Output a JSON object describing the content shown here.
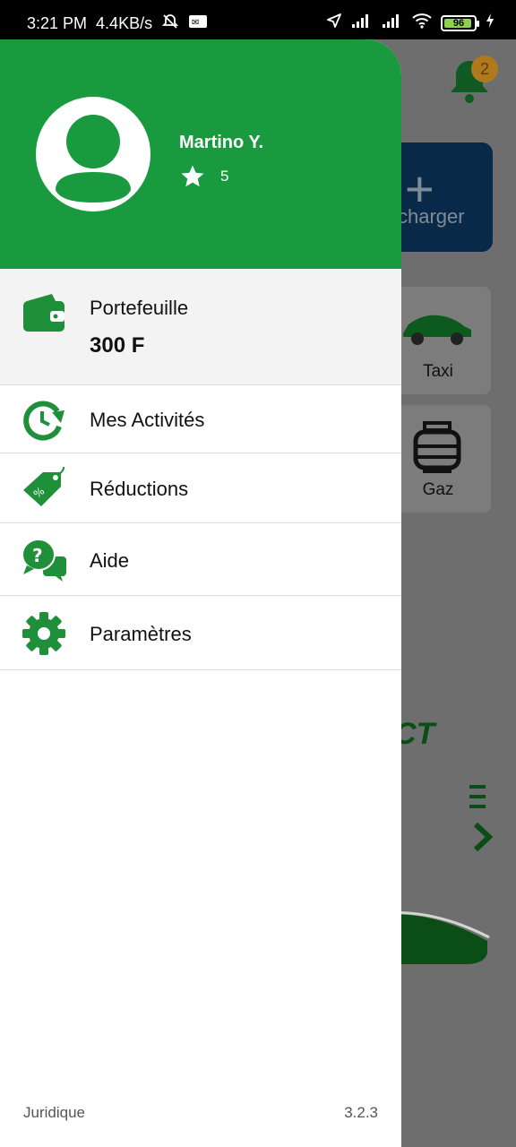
{
  "status_bar": {
    "time": "3:21 PM",
    "speed": "4.4KB/s",
    "battery": "96"
  },
  "background_app": {
    "notification_count": "2",
    "recharge_label": "charger",
    "taxi_label": "Taxi",
    "gas_label": "Gaz",
    "brand_fragment": "CT"
  },
  "drawer": {
    "user_name": "Martino Y.",
    "rating": "5",
    "wallet": {
      "label": "Portefeuille",
      "amount": "300 F"
    },
    "menu_items": [
      {
        "label": "Mes Activités",
        "icon": "history-icon"
      },
      {
        "label": "Réductions",
        "icon": "discount-tag-icon"
      },
      {
        "label": "Aide",
        "icon": "help-chat-icon"
      },
      {
        "label": "Paramètres",
        "icon": "gear-icon"
      }
    ],
    "footer": {
      "legal": "Juridique",
      "version": "3.2.3"
    }
  },
  "colors": {
    "brand_green": "#1a9a3e",
    "icon_green": "#1f8f3a"
  }
}
